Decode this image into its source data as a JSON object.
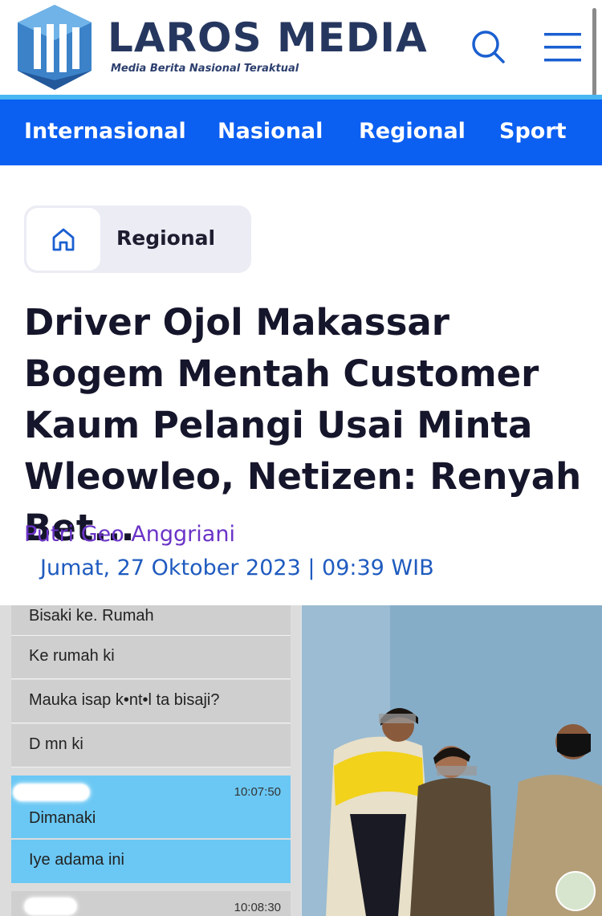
{
  "header": {
    "brand_name": "LAROS MEDIA",
    "tagline": "Media Berita Nasional Teraktual",
    "search_icon": "search-icon",
    "menu_icon": "hamburger-menu-icon",
    "brand_color": "#26375f"
  },
  "nav": {
    "bg_color": "#0b5ff1",
    "items": [
      {
        "label": "Internasional"
      },
      {
        "label": "Nasional"
      },
      {
        "label": "Regional"
      },
      {
        "label": "Sport"
      }
    ]
  },
  "breadcrumb": {
    "home_icon": "home-icon",
    "category": "Regional"
  },
  "article": {
    "title": "Driver Ojol Makassar Bogem Mentah Customer Kaum Pelangi Usai Minta Wleowleo, Netizen: Renyah Bet...",
    "author": "Putri Geo Anggriani",
    "published": "Jumat, 27 Oktober 2023 | 09:39 WIB",
    "author_color": "#6a33c7",
    "date_color": "#1f5bbf"
  },
  "image": {
    "chat_messages": [
      {
        "text": "Bisaki ke. Rumah",
        "type": "in"
      },
      {
        "text": "Ke rumah ki",
        "type": "in"
      },
      {
        "text": "Mauka isap k•nt•l ta bisaji?",
        "type": "in"
      },
      {
        "text": "D mn ki",
        "type": "in"
      },
      {
        "text": "Dimanaki",
        "type": "out",
        "time": "10:07:50"
      },
      {
        "text": "Iye adama ini",
        "type": "out"
      },
      {
        "text": "",
        "type": "in",
        "time": "10:08:30"
      }
    ]
  }
}
